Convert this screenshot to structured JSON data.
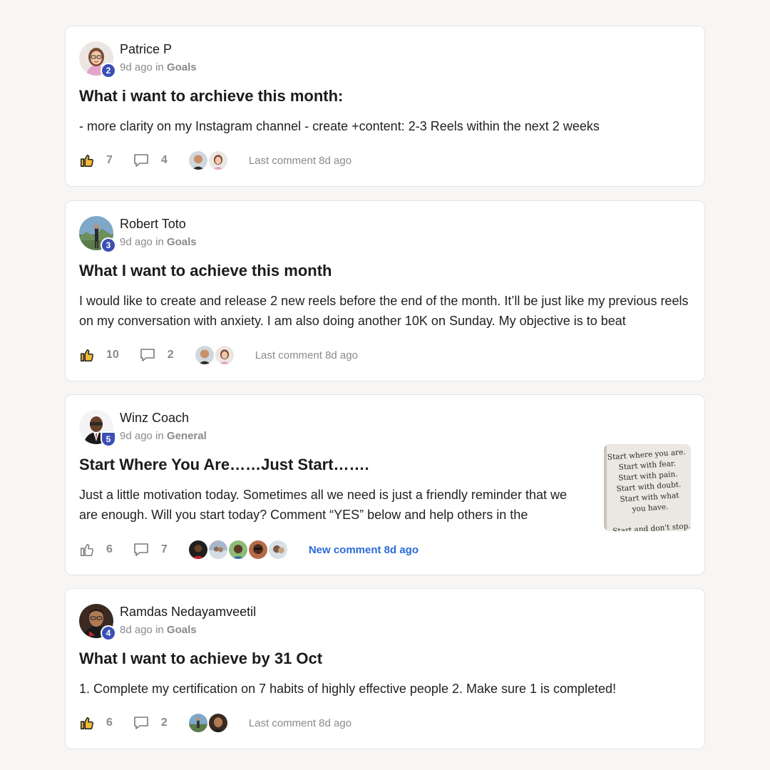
{
  "posts": [
    {
      "author": "Patrice P",
      "level": "2",
      "time": "9d ago",
      "in_word": "in",
      "category": "Goals",
      "title": "What i want to archieve this month:",
      "body": "- more clarity on my Instagram channel - create +content: 2-3 Reels within the next 2 weeks",
      "likes": "7",
      "comments": "4",
      "last_comment": "Last comment 8d ago"
    },
    {
      "author": "Robert Toto",
      "level": "3",
      "time": "9d ago",
      "in_word": "in",
      "category": "Goals",
      "title": "What I want to achieve this month",
      "body": "I would like to create and release 2 new reels before the end of the month. It’ll be just like my previous reels on my conversation with anxiety. I am also doing another 10K on Sunday. My objective is to beat",
      "likes": "10",
      "comments": "2",
      "last_comment": "Last comment 8d ago"
    },
    {
      "author": "Winz Coach",
      "level": "5",
      "time": "9d ago",
      "in_word": "in",
      "category": "General",
      "title": "Start Where You Are……Just Start…….",
      "body": "Just a little motivation today. Sometimes all we need is just a friendly reminder that we are enough. Will you start today? Comment “YES” below and help others in the",
      "likes": "6",
      "comments": "7",
      "last_comment": "New comment 8d ago",
      "image_lines": [
        "Start where you are.",
        "Start with fear.",
        "Start with pain.",
        "Start with doubt.",
        "Start with what",
        "you have.",
        "Start and don't stop."
      ]
    },
    {
      "author": "Ramdas Nedayamveetil",
      "level": "4",
      "time": "8d ago",
      "in_word": "in",
      "category": "Goals",
      "title": "What I want to achieve by 31 Oct",
      "body": "1. Complete my certification on 7 habits of highly effective people 2. Make sure 1 is completed!",
      "likes": "6",
      "comments": "2",
      "last_comment": "Last comment 8d ago"
    }
  ],
  "colors": {
    "background": "#f7f6f4",
    "card": "#ffffff",
    "badge": "#3b4fb5",
    "like_liked": "#f2b93b",
    "link_blue": "#2a6cd8",
    "muted": "#8a8a8a"
  },
  "icons": {
    "like": "thumbs-up-icon",
    "comment": "speech-bubble-icon"
  }
}
